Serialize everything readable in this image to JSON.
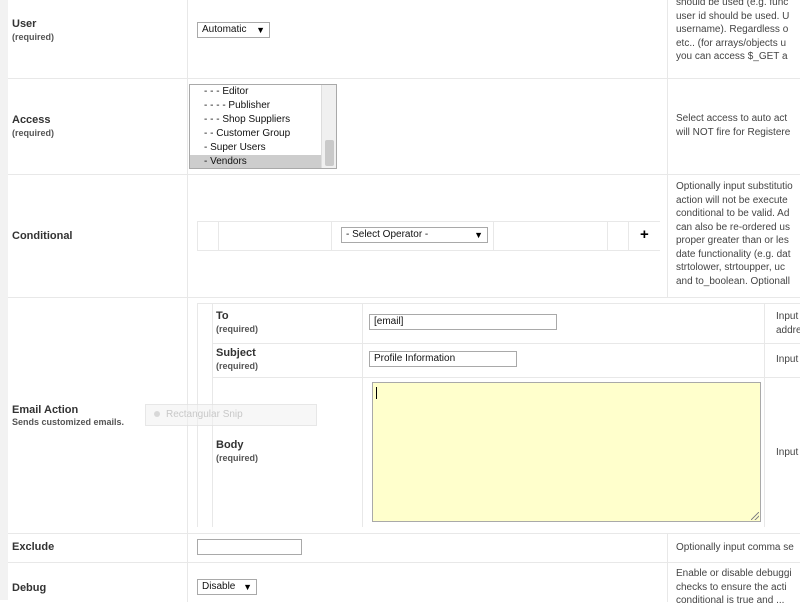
{
  "user_row": {
    "label": "User",
    "required": "(required)",
    "select_value": "Automatic",
    "desc": [
      "should be used (e.g. func",
      "user id should be used. U",
      "username). Regardless o",
      "etc.. (for arrays/objects u",
      "you can access $_GET a"
    ]
  },
  "access_row": {
    "label": "Access",
    "required": "(required)",
    "options": [
      "- - - Editor",
      "- - - - Publisher",
      "- - - Shop Suppliers",
      "- - Customer Group",
      "- Super Users",
      "- Vendors"
    ],
    "selected_index": 5,
    "desc": [
      "Select access to auto act",
      "will NOT fire for Registere"
    ]
  },
  "conditional_row": {
    "label": "Conditional",
    "operator_select": "- Select Operator -",
    "add_symbol": "+",
    "desc": [
      "Optionally input substitutio",
      "action will not be execute",
      "conditional to be valid. Ad",
      "can also be re-ordered us",
      "proper greater than or les",
      "date functionality (e.g. dat",
      "strtolower, strtoupper, uc",
      "and to_boolean. Optionall"
    ]
  },
  "email_row": {
    "label": "Email Action",
    "sub": "Sends customized emails.",
    "to_label": "To",
    "to_required": "(required)",
    "to_value": "[email]",
    "to_desc": [
      "Input",
      "addre"
    ],
    "subject_label": "Subject",
    "subject_required": "(required)",
    "subject_value": "Profile Information",
    "subject_desc": "Input",
    "body_label": "Body",
    "body_required": "(required)",
    "body_desc": "Input"
  },
  "snip_overlay": {
    "text": "Rectangular Snip"
  },
  "exclude_row": {
    "label": "Exclude",
    "value": "",
    "desc": "Optionally input comma se"
  },
  "debug_row": {
    "label": "Debug",
    "select_value": "Disable",
    "desc": [
      "Enable or disable debuggi",
      "checks to ensure the acti",
      "conditional is true and ..."
    ]
  }
}
